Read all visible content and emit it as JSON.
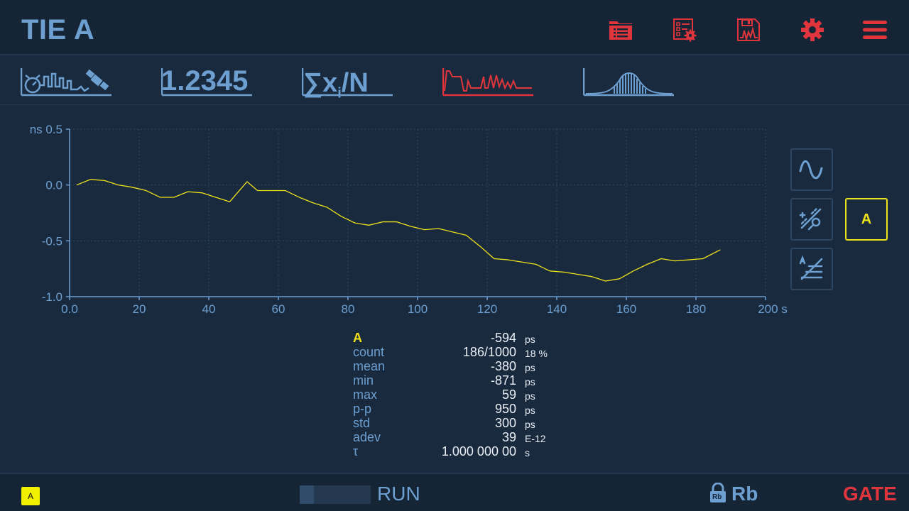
{
  "header": {
    "title": "TIE A",
    "buttons": [
      {
        "name": "folder-list-icon"
      },
      {
        "name": "settings-list-icon"
      },
      {
        "name": "save-chart-icon"
      },
      {
        "name": "gear-icon"
      },
      {
        "name": "hamburger-menu-icon"
      }
    ]
  },
  "modes": {
    "value_display": "1.2345",
    "stats_display": "∑x",
    "stats_sub": "i",
    "stats_tail": "/N"
  },
  "colors": {
    "accent": "#6d9fd0",
    "alert": "#e0353c",
    "trace": "#f0e21a",
    "background": "#192a3e"
  },
  "chart_data": {
    "type": "line",
    "ylabel": "ns",
    "xlabel_unit": "s",
    "xlim": [
      0,
      200
    ],
    "ylim": [
      -1.0,
      0.5
    ],
    "xticks": [
      "0.0",
      "20",
      "40",
      "60",
      "80",
      "100",
      "120",
      "140",
      "160",
      "180",
      "200"
    ],
    "yticks": [
      "0.5",
      "0.0",
      "-0.5",
      "-1.0"
    ],
    "grid": true,
    "series": [
      {
        "color": "#f0e21a",
        "x": [
          2,
          6,
          10,
          14,
          18,
          22,
          26,
          30,
          34,
          38,
          42,
          46,
          51,
          54,
          58,
          62,
          66,
          70,
          74,
          78,
          82,
          86,
          90,
          94,
          98,
          102,
          106,
          110,
          114,
          118,
          122,
          126,
          130,
          134,
          138,
          142,
          146,
          150,
          154,
          158,
          162,
          166,
          170,
          174,
          178,
          182,
          187
        ],
        "y": [
          0.0,
          0.05,
          0.04,
          0.0,
          -0.02,
          -0.05,
          -0.11,
          -0.11,
          -0.06,
          -0.07,
          -0.11,
          -0.15,
          0.03,
          -0.05,
          -0.05,
          -0.05,
          -0.11,
          -0.16,
          -0.2,
          -0.28,
          -0.34,
          -0.36,
          -0.33,
          -0.33,
          -0.37,
          -0.4,
          -0.39,
          -0.42,
          -0.45,
          -0.55,
          -0.66,
          -0.67,
          -0.69,
          -0.71,
          -0.77,
          -0.78,
          -0.8,
          -0.82,
          -0.86,
          -0.84,
          -0.77,
          -0.71,
          -0.66,
          -0.68,
          -0.67,
          -0.66,
          -0.58
        ]
      }
    ]
  },
  "side": {
    "channel_button": "A"
  },
  "stats": {
    "channel": {
      "label": "A",
      "value": "-594",
      "unit": "ps"
    },
    "rows": [
      {
        "label": "count",
        "value": "186/1000",
        "unit": "18 %"
      },
      {
        "label": "mean",
        "value": "-380",
        "unit": "ps"
      },
      {
        "label": "min",
        "value": "-871",
        "unit": "ps"
      },
      {
        "label": "max",
        "value": "59",
        "unit": "ps"
      },
      {
        "label": "p-p",
        "value": "950",
        "unit": "ps"
      },
      {
        "label": "std",
        "value": "300",
        "unit": "ps"
      },
      {
        "label": "adev",
        "value": "39",
        "unit": "E-12"
      },
      {
        "label": "τ",
        "value": "1.000 000 00",
        "unit": "s"
      }
    ]
  },
  "footer": {
    "channel_badge": "A",
    "progress": 0.2,
    "run_label": "RUN",
    "lock_text": "Rb",
    "reference": "Rb",
    "gate": "GATE"
  }
}
